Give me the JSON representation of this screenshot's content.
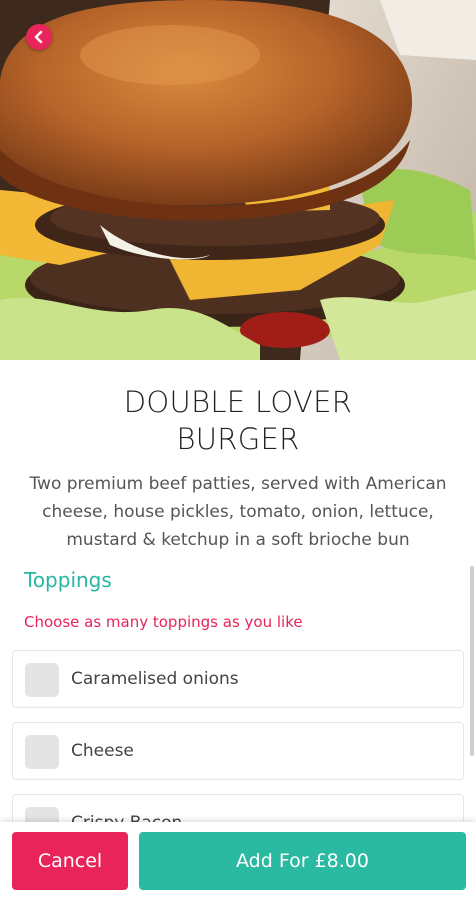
{
  "product": {
    "title_line1": "DOUBLE LOVER",
    "title_line2": "BURGER",
    "description": "Two premium beef patties, served with American cheese, house pickles, tomato, onion, lettuce, mustard & ketchup in a soft brioche bun"
  },
  "toppings": {
    "heading": "Toppings",
    "hint": "Choose as many toppings as you like",
    "options": [
      {
        "label": "Caramelised onions",
        "checked": false
      },
      {
        "label": "Cheese",
        "checked": false
      },
      {
        "label": "Crispy Bacon",
        "checked": false
      }
    ]
  },
  "actions": {
    "cancel_label": "Cancel",
    "add_label": "Add For £8.00"
  },
  "icons": {
    "back": "chevron-left-icon",
    "checkbox": "checkbox-icon"
  },
  "colors": {
    "accent_pink": "#e8245a",
    "accent_teal": "#2ab9a1",
    "heading_teal": "#26b7a3"
  }
}
